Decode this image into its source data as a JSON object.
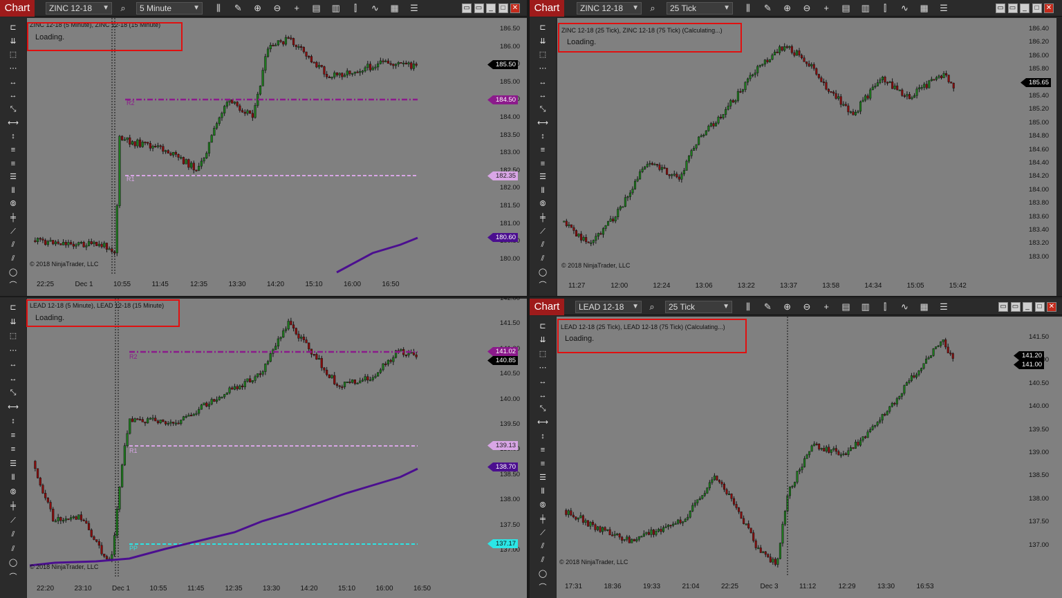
{
  "colors": {
    "up_candle": "#1e7b1e",
    "down_candle": "#8b0d0d",
    "chart_tab": "#9e1b1b",
    "pivot_r2": "#8b1a8b",
    "pivot_r1": "#d9a6e6",
    "pivot_pp": "#2be6e6",
    "sma_line": "#4b0f8f",
    "annotation_box": "#e01010"
  },
  "panels": [
    {
      "chart_tab": "Chart",
      "instrument": "ZINC 12-18",
      "interval": "5 Minute",
      "header": "ZINC 12-18 (5 Minute), ZINC 12-18 (15 Minute)",
      "loading": "Loading.",
      "copyright": "© 2018 NinjaTrader, LLC",
      "y_ticks": [
        "186.50",
        "186.00",
        "185.50",
        "185.00",
        "184.50",
        "184.00",
        "183.50",
        "183.00",
        "182.50",
        "182.00",
        "181.50",
        "181.00",
        "180.50",
        "180.00"
      ],
      "x_ticks": [
        "22:25",
        "Dec 1",
        "10:55",
        "11:45",
        "12:35",
        "13:30",
        "14:20",
        "15:10",
        "16:00",
        "16:50"
      ],
      "price_labels": [
        {
          "text": "185.50",
          "kind": "last"
        },
        {
          "text": "184.50",
          "kind": "r2"
        },
        {
          "text": "182.35",
          "kind": "r1"
        },
        {
          "text": "180.60",
          "kind": "sma"
        }
      ],
      "level_names": [
        "R2",
        "R1"
      ]
    },
    {
      "chart_tab": "Chart",
      "instrument": "ZINC 12-18",
      "interval": "25 Tick",
      "header": "ZINC 12-18 (25 Tick), ZINC 12-18 (75 Tick) (Calculating...)",
      "loading": "Loading.",
      "copyright": "© 2018 NinjaTrader, LLC",
      "y_ticks": [
        "186.40",
        "186.20",
        "186.00",
        "185.80",
        "185.60",
        "185.40",
        "185.20",
        "185.00",
        "184.80",
        "184.60",
        "184.40",
        "184.20",
        "184.00",
        "183.80",
        "183.60",
        "183.40",
        "183.20",
        "183.00"
      ],
      "x_ticks": [
        "11:27",
        "12:00",
        "12:24",
        "13:06",
        "13:22",
        "13:37",
        "13:58",
        "14:34",
        "15:05",
        "15:42"
      ],
      "price_labels": [
        {
          "text": "185.65",
          "kind": "last"
        }
      ],
      "level_names": []
    },
    {
      "chart_tab": "Chart",
      "instrument": "LEAD 12-18",
      "interval": "5 Minute",
      "header": "LEAD 12-18 (5 Minute), LEAD 12-18 (15 Minute)",
      "loading": "Loading.",
      "copyright": "© 2018 NinjaTrader, LLC",
      "y_ticks": [
        "142.00",
        "141.50",
        "141.00",
        "140.50",
        "140.00",
        "139.50",
        "139.00",
        "138.50",
        "138.00",
        "137.50",
        "137.00"
      ],
      "x_ticks": [
        "22:20",
        "23:10",
        "Dec 1",
        "10:55",
        "11:45",
        "12:35",
        "13:30",
        "14:20",
        "15:10",
        "16:00",
        "16:50"
      ],
      "price_labels": [
        {
          "text": "141.02",
          "kind": "r2"
        },
        {
          "text": "140.85",
          "kind": "last"
        },
        {
          "text": "139.13",
          "kind": "r1"
        },
        {
          "text": "138.70",
          "kind": "sma"
        },
        {
          "text": "137.17",
          "kind": "pp"
        }
      ],
      "level_names": [
        "R2",
        "R1",
        "PP"
      ]
    },
    {
      "chart_tab": "Chart",
      "instrument": "LEAD 12-18",
      "interval": "25 Tick",
      "header": "LEAD 12-18 (25 Tick), LEAD 12-18 (75 Tick) (Calculating...)",
      "loading": "Loading.",
      "copyright": "© 2018 NinjaTrader, LLC",
      "y_ticks": [
        "141.50",
        "141.00",
        "140.50",
        "140.00",
        "139.50",
        "139.00",
        "138.50",
        "138.00",
        "137.50",
        "137.00"
      ],
      "x_ticks": [
        "17:31",
        "18:36",
        "19:33",
        "21:04",
        "22:25",
        "Dec 3",
        "11:12",
        "12:29",
        "13:30",
        "16:53"
      ],
      "price_labels": [
        {
          "text": "141.20",
          "kind": "last"
        },
        {
          "text": "141.00",
          "kind": "bid"
        }
      ],
      "level_names": []
    }
  ],
  "toolbar_icons": [
    "bars-type-icon",
    "draw-pencil-icon",
    "zoom-in-icon",
    "zoom-out-icon",
    "crosshair-icon",
    "properties-icon",
    "indicators-icon",
    "strategies-icon",
    "line-chart-icon",
    "templates-icon",
    "more-menu-icon"
  ],
  "toolbar_glyphs": [
    "⫼",
    "✎",
    "⊕",
    "⊖",
    "+",
    "▤",
    "▥",
    "⫿",
    "∿",
    "▦",
    "☰"
  ],
  "window_buttons": [
    "▭",
    "▭",
    "_",
    "□",
    "✕"
  ],
  "drawing_tools": [
    "⊏",
    "⇊",
    "⬚",
    "⋯",
    "↔",
    "↔",
    "⤡",
    "⟷",
    "↕",
    "≡",
    "≡",
    "☰",
    "⦀",
    "⦾",
    "╪",
    "⟋",
    "⫽",
    "⫽",
    "◯",
    "⌒"
  ]
}
